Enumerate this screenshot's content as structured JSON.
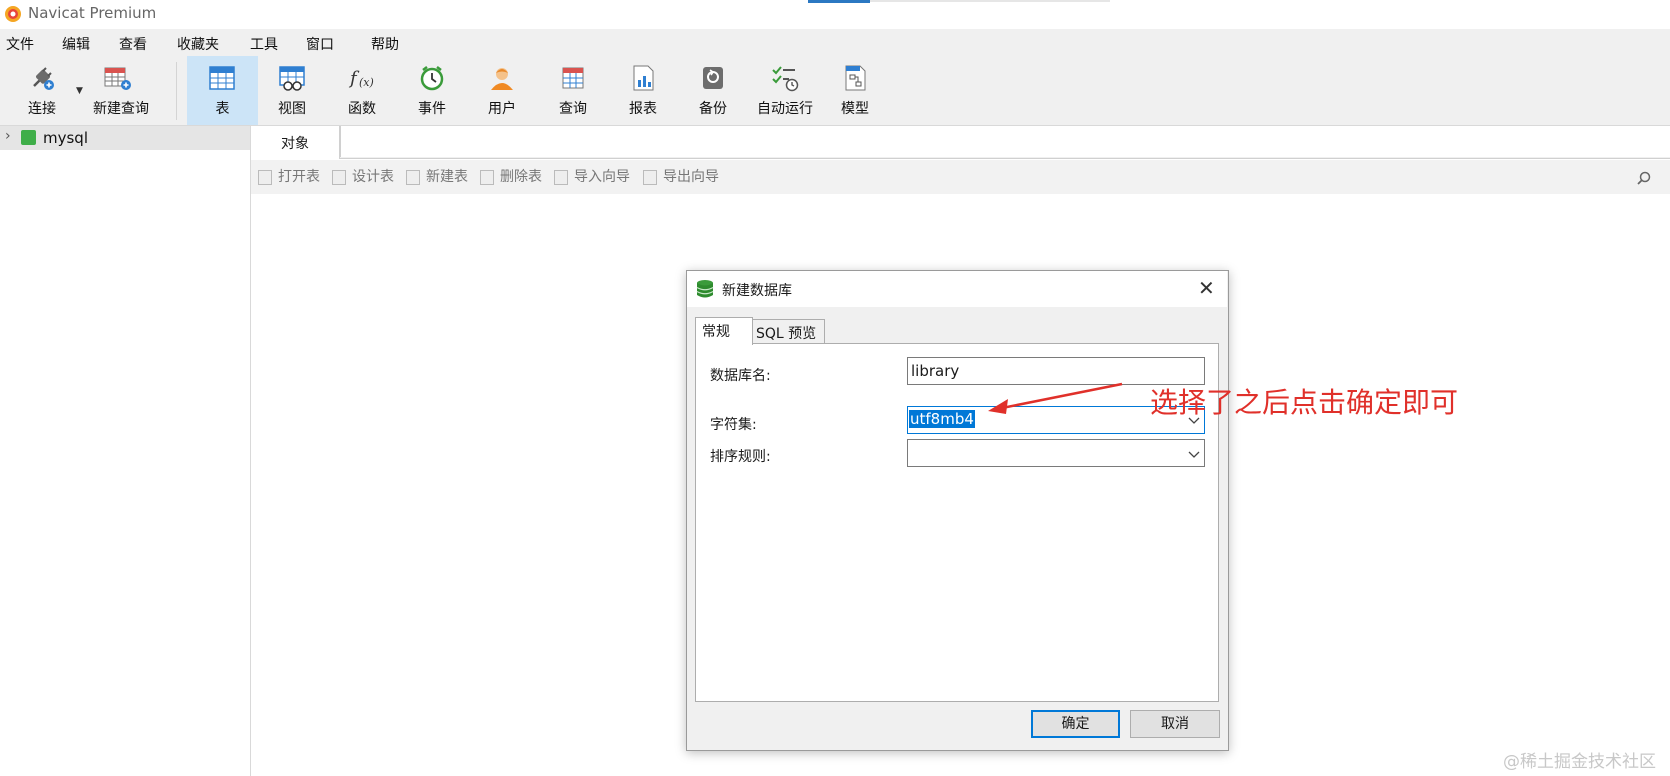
{
  "window": {
    "title": "Navicat Premium"
  },
  "menubar": {
    "items": [
      "文件",
      "编辑",
      "查看",
      "收藏夹",
      "工具",
      "窗口",
      "帮助"
    ]
  },
  "toolbar": {
    "connect": "连接",
    "new_query": "新建查询",
    "buttons": [
      "表",
      "视图",
      "函数",
      "事件",
      "用户",
      "查询",
      "报表",
      "备份",
      "自动运行",
      "模型"
    ],
    "active": "表"
  },
  "sidebar": {
    "connection": "mysql"
  },
  "main": {
    "tab": "对象",
    "object_toolbar": [
      "打开表",
      "设计表",
      "新建表",
      "删除表",
      "导入向导",
      "导出向导"
    ]
  },
  "dialog": {
    "title": "新建数据库",
    "tabs": [
      "常规",
      "SQL 预览"
    ],
    "active_tab": "常规",
    "fields": {
      "db_name_label": "数据库名:",
      "db_name_value": "library",
      "charset_label": "字符集:",
      "charset_value": "utf8mb4",
      "collation_label": "排序规则:",
      "collation_value": ""
    },
    "ok": "确定",
    "cancel": "取消"
  },
  "annotation": {
    "text": "选择了之后点击确定即可",
    "color": "#e0302a"
  },
  "watermark": "@稀土掘金技术社区",
  "colors": {
    "accent": "#0078d7",
    "active_tool": "#cce4f7"
  }
}
